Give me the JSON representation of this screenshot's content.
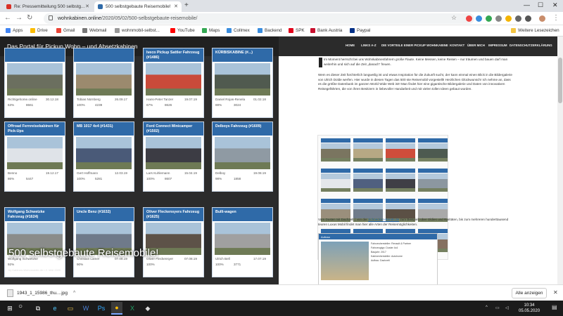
{
  "browser": {
    "tabs": [
      {
        "title": "Re: Pressemitteilung 500 selbstg...",
        "active": false,
        "favicon_color": "#d93025"
      },
      {
        "title": "500 selbstgebaute Reisemobile!",
        "active": true,
        "favicon_color": "#2f6aa8"
      }
    ],
    "new_tab_icon": "+",
    "url_host": "wohnkabinen.online",
    "url_path": "/2020/05/02/500-selbstgebaute-reisemobile/",
    "bookmarks": [
      {
        "label": "Apps",
        "color": "#4285f4"
      },
      {
        "label": "Drive",
        "color": "#fbbc04"
      },
      {
        "label": "Gmail",
        "color": "#ea4335"
      },
      {
        "label": "Webmail",
        "color": "#777777"
      },
      {
        "label": "wohnmobil-selbst...",
        "color": "#999999"
      },
      {
        "label": "YouTube",
        "color": "#ff0000"
      },
      {
        "label": "Maps",
        "color": "#34a853"
      },
      {
        "label": "Collmex",
        "color": "#3a8dde"
      },
      {
        "label": "Backend",
        "color": "#3a8dde"
      },
      {
        "label": "SPK",
        "color": "#e2001a"
      },
      {
        "label": "Bank Austria",
        "color": "#c8102e"
      },
      {
        "label": "Paypal",
        "color": "#003087"
      }
    ],
    "other_bookmarks": "Weitere Lesezeichen"
  },
  "site": {
    "title": "Das Portal für Pickup Wohn – und Absetzkabinen",
    "nav": [
      "HOME",
      "LINKS A-Z",
      "DIE VORTEILE EINER PICKUP WOHNKABINE",
      "KONTAKT",
      "ÜBER MICH",
      "IMPRESSUM",
      "DATENSCHUTZERKLÄRUNG"
    ],
    "hero_title": "500 selbstgebaute Reisemobile!",
    "hero_meta": "by Kabinen-Wohnmobile.de • 2. MAI 2020",
    "cards": [
      {
        "title": "",
        "date": "30.12.18",
        "user": "Richtigehome.online",
        "pct": "63%",
        "views": "8661"
      },
      {
        "title": "",
        "date": "26.09.17",
        "user": "Tobias Nürnberg",
        "pct": "100%",
        "views": "4239"
      },
      {
        "title": "Iveco Pickup Sattler Fahrzeug (#1486)",
        "date": "19.07.19",
        "user": "Hans-Peter Tanzer",
        "pct": "67%",
        "views": "8626"
      },
      {
        "title": "KÜRBISKABINE (#...)",
        "date": "01.02.18",
        "user": "Daniel Rojas-Renela",
        "pct": "88%",
        "views": "3024"
      },
      {
        "title": "Offroad Fernreisekabinen für Pick-Ups",
        "date": "19.12.17",
        "user": "Benno",
        "pct": "86%",
        "views": "5447"
      },
      {
        "title": "MB 1017 4x4 (#1431)",
        "date": "12.03.19",
        "user": "Gert Hoffmann",
        "pct": "100%",
        "views": "5281"
      },
      {
        "title": "Ford Connect Minicamper (#1502)",
        "date": "15.04.19",
        "user": "Lars Kuhlemann",
        "pct": "100%",
        "views": "8607"
      },
      {
        "title": "Delboys Fahrzeug (#1609)",
        "date": "19.08.19",
        "user": "Delboy",
        "pct": "98%",
        "views": "1858"
      },
      {
        "title": "Wolfgang Schwetzke Fahrzeug (#1624)",
        "date": "",
        "user": "Wolfgang Schwetzke",
        "pct": "92%",
        "views": ""
      },
      {
        "title": "Uncle Benz (#1632)",
        "date": "07.08.19",
        "user": "Christian Lamer",
        "pct": "90%",
        "views": ""
      },
      {
        "title": "Oliver Fleckensyers Fahrzeug (#1625)",
        "date": "07.08.19",
        "user": "Oliver Fleckensyer",
        "pct": "100%",
        "views": ""
      },
      {
        "title": "Bulli-wagen",
        "date": "17.07.19",
        "user": "Ulrich Bell",
        "pct": "100%",
        "views": "3771"
      }
    ],
    "intro_p1": "Im Moment herrscht bei uns Wohnkabinenfahrern große Flaute. Keine Messen, keine Reisen – nur träumen und bauen darf man weiterhin und sich auf die Zeit „danach“ freuen.",
    "intro_p2": "Wem es dieser Zeit fürchterlich langweilig ist und etwas Inspiration für die Zukunft sucht, der kann einmal einen Blick in die Bildergalerie von Ulrich Dolde werfen. Hier wurde in diesen Tagen das 500 ste Reisemobil vorgestellt! Herzlichen Glückwunsch! Ich nehme an, dass es die größte Datenbank im ganzen World Wide Web ist!! Man findet hier eine gigantische Bildergalerie und Daten von innovativen Reisegefährten, die von ihren Besitzern in liebevoller Handarbeit und mit vielen tollen Ideen gebaut wurden.",
    "intro_p3_pre": "Vom Duster mit Dachzelt ( von der ",
    "intro_p3_link": "Schnecken-Bande.de",
    "intro_p3_post": " zum Beispiel) über Oldies und Raritäten, bis zum mehreren hunderttausend teuren Luxus Mobil findet man hier alle Arten der Reisemöglichkeiten.",
    "ad_header": "Aufnaa",
    "ad_rows": [
      "Fahrzeuhersteller: Renault & Partner",
      "Fahrzeugtyp: Duster 4x4",
      "Baujahr: 2017",
      "Kabinenhersteller: Autohome",
      "Aufbau: Dachzelt"
    ]
  },
  "downloads": {
    "file": "1943_1_15986_thu....jpg",
    "show_all": "Alle anzeigen"
  },
  "taskbar": {
    "time": "10:34",
    "date": "05.05.2020"
  },
  "colors": {
    "accent": "#2f6aa8",
    "dark": "#2b2b2b"
  }
}
